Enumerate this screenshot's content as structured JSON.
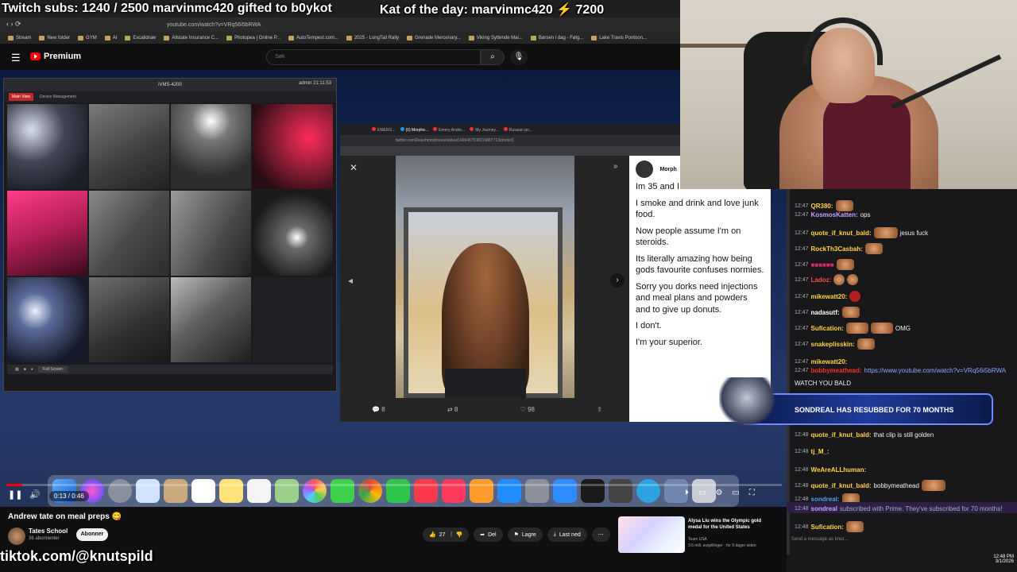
{
  "overlay": {
    "subs_text": "Twitch subs: 1240 / 2500 marvinmc420 gifted to b0ykot",
    "kat_text": "Kat of the day: marvinmc420 ⚡ 7200",
    "tiktok": "tiktok.com/@knutspild"
  },
  "browser": {
    "url": "youtube.com/watch?v=VRq56i5bRWA",
    "bookmarks": [
      "Stream",
      "New folder",
      "GYM",
      "AI",
      "Excalidraw",
      "Allstate Insurance C...",
      "Photopea | Online P...",
      "AutoTempest.com...",
      "2025 - LongTail Rally",
      "Grenade Mercenary...",
      "Viking Syttende Mai...",
      "Børsen i dag - Følg...",
      "Lake Travis Pontoon..."
    ]
  },
  "youtube": {
    "logo": "Premium",
    "search_placeholder": "Søk",
    "video_title": "Andrew tate on meal preps 😋",
    "channel": "Tates School",
    "subscribers": "36 abonnenter",
    "subscribe_label": "Abonner",
    "likes": "27",
    "share_label": "Del",
    "save_label": "Lagre",
    "download_label": "Last ned",
    "time": "0:13 / 0:46",
    "progress": 0.021,
    "recommended": {
      "title": "Alysa Liu wins the Olympic gold medal for the United States",
      "channel": "Team USA",
      "meta": "3,6 mill. avspillinger · for 9 dager siden"
    }
  },
  "cctv": {
    "title": "iVMS-4200",
    "user": "admin  21:11:53",
    "tabs": [
      "Main View",
      "Device Management"
    ],
    "fullscreen_label": "Full Screen"
  },
  "tweet": {
    "url": "twitter.com/Reachmorpheus/status/1496467538219887713/photo/1",
    "user": "Morph",
    "paragraphs": [
      "Im 35 and I train at home.",
      "I smoke and drink and love junk food.",
      "Now people assume I'm on steroids.",
      "Its literally amazing how being gods favourite confuses normies.",
      "Sorry you dorks need injections and meal plans and powders and to give up donuts.",
      "I don't.",
      "I'm your superior."
    ]
  },
  "chat": {
    "messages": [
      {
        "ts": "12:47",
        "user": "QR380:",
        "text": "",
        "color": "#ffd14a"
      },
      {
        "ts": "12:47",
        "user": "KosmosKatten:",
        "text": "ops",
        "color": "#c6a0ff"
      },
      {
        "ts": "12:47",
        "user": "quote_if_knut_bald:",
        "text": "jesus fuck",
        "color": "#ffd14a"
      },
      {
        "ts": "12:47",
        "user": "RockTh3Casbah:",
        "text": "",
        "color": "#ffd14a"
      },
      {
        "ts": "12:47",
        "user": "",
        "text": "",
        "color": "#d42c6a"
      },
      {
        "ts": "12:47",
        "user": "Ladoz:",
        "text": "",
        "color": "#ff4a4a"
      },
      {
        "ts": "12:47",
        "user": "mikewatt20:",
        "text": "",
        "color": "#ffd14a"
      },
      {
        "ts": "12:47",
        "user": "nadasutf:",
        "text": "",
        "color": "#ffffff"
      },
      {
        "ts": "12:47",
        "user": "Sufication:",
        "text": "OMG",
        "color": "#ffd14a"
      },
      {
        "ts": "12:47",
        "user": "snakeplisskin:",
        "text": "",
        "color": "#ffd14a"
      },
      {
        "ts": "12:47",
        "user": "mikewatt20:",
        "text": "",
        "color": "#ffd14a"
      },
      {
        "ts": "12:47",
        "user": "bobbymeathead:",
        "text": "https://www.youtube.com/watch?v=VRq56i5bRWA",
        "color": "#ff2a2a"
      },
      {
        "ts": "",
        "user": "",
        "text": "WATCH YOU BALD",
        "color": "#ffffff"
      },
      {
        "ts": "12:48",
        "user": "quote_if_knut_bald:",
        "text": "that clip is still golden",
        "color": "#ffd14a"
      },
      {
        "ts": "12:48",
        "user": "tj_M_:",
        "text": "",
        "color": "#ffd14a"
      },
      {
        "ts": "12:48",
        "user": "WeAreALLhuman:",
        "text": "",
        "color": "#ffd14a"
      },
      {
        "ts": "12:48",
        "user": "quote_if_knut_bald:",
        "text": "bobbymeathead",
        "color": "#ffd14a"
      },
      {
        "ts": "12:48",
        "user": "sondreal:",
        "text": "",
        "color": "#4aa0ff"
      },
      {
        "ts": "12:48",
        "user": "sondreal",
        "text": "subscribed with Prime. They've subscribed for 70 months!",
        "color": "#c6a0ff"
      },
      {
        "ts": "12:48",
        "user": "Sufication:",
        "text": "",
        "color": "#ffd14a"
      }
    ],
    "sub_alert": "SONDREAL HAS RESUBBED FOR 70 MONTHS",
    "input_placeholder": "Send a message as knut..."
  },
  "taskbar": {
    "time": "12:48 PM",
    "date": "3/1/2026"
  }
}
